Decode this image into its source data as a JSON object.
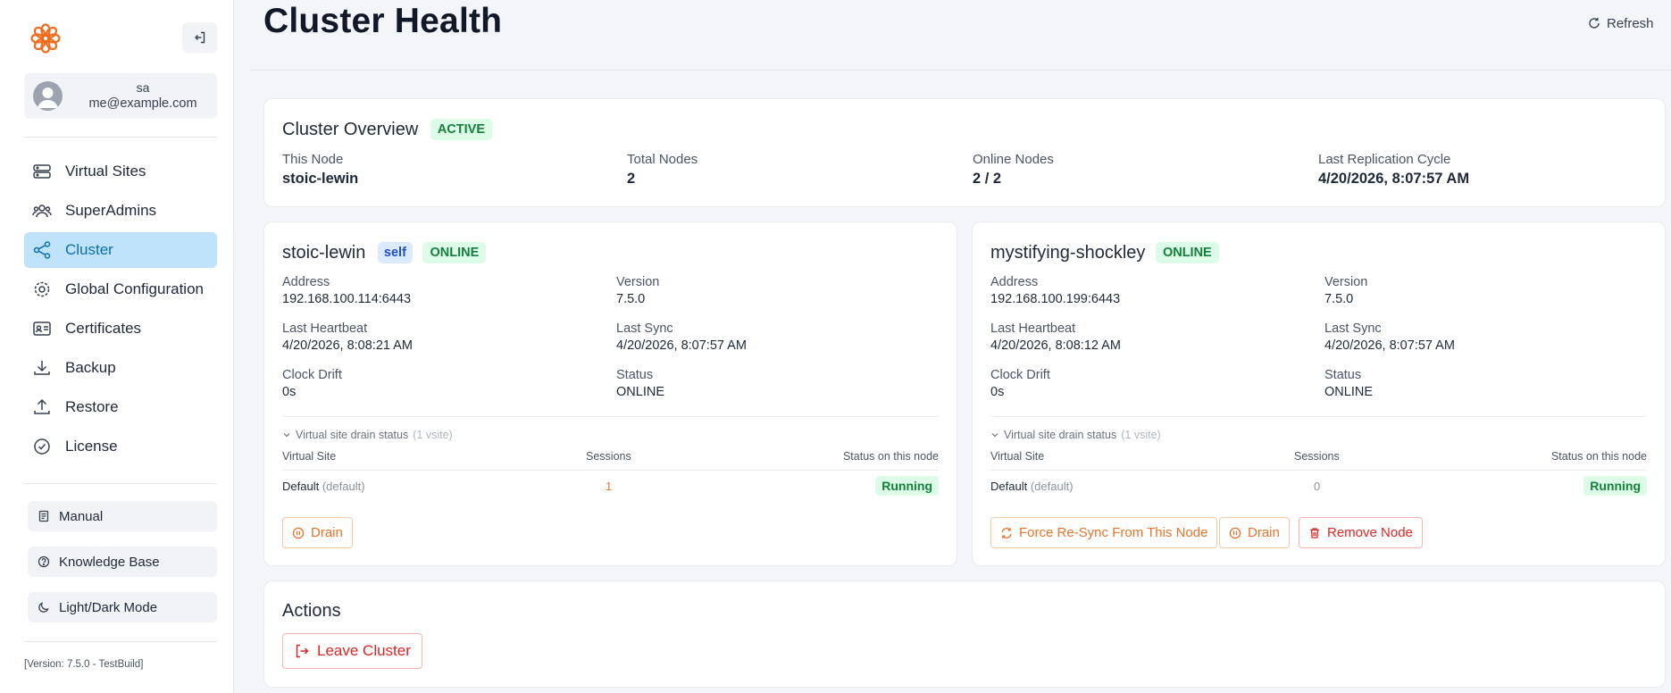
{
  "sidebar": {
    "user": {
      "name": "sa",
      "email": "me@example.com"
    },
    "nav": [
      {
        "label": "Virtual Sites",
        "icon": "server-stack-icon"
      },
      {
        "label": "SuperAdmins",
        "icon": "users-icon"
      },
      {
        "label": "Cluster",
        "icon": "share-nodes-icon",
        "active": true
      },
      {
        "label": "Global Configuration",
        "icon": "gear-icon"
      },
      {
        "label": "Certificates",
        "icon": "id-card-icon"
      },
      {
        "label": "Backup",
        "icon": "download-icon"
      },
      {
        "label": "Restore",
        "icon": "upload-icon"
      },
      {
        "label": "License",
        "icon": "check-badge-icon"
      }
    ],
    "footer": [
      {
        "label": "Manual",
        "icon": "document-icon"
      },
      {
        "label": "Knowledge Base",
        "icon": "question-circle-icon"
      },
      {
        "label": "Light/Dark Mode",
        "icon": "moon-icon"
      }
    ],
    "version": "[Version: 7.5.0 - TestBuild]"
  },
  "header": {
    "title": "Cluster Health",
    "refresh_label": "Refresh"
  },
  "overview": {
    "title": "Cluster Overview",
    "status": "ACTIVE",
    "fields": [
      {
        "label": "This Node",
        "value": "stoic-lewin"
      },
      {
        "label": "Total Nodes",
        "value": "2"
      },
      {
        "label": "Online Nodes",
        "value": "2 / 2"
      },
      {
        "label": "Last Replication Cycle",
        "value": "4/20/2026, 8:07:57 AM"
      }
    ]
  },
  "nodes": [
    {
      "name": "stoic-lewin",
      "self_badge": "self",
      "status_badge": "ONLINE",
      "fields": [
        {
          "label": "Address",
          "value": "192.168.100.114:6443"
        },
        {
          "label": "Version",
          "value": "7.5.0"
        },
        {
          "label": "Last Heartbeat",
          "value": "4/20/2026, 8:08:21 AM"
        },
        {
          "label": "Last Sync",
          "value": "4/20/2026, 8:07:57 AM"
        },
        {
          "label": "Clock Drift",
          "value": "0s"
        },
        {
          "label": "Status",
          "value": "ONLINE"
        }
      ],
      "drain": {
        "heading": "Virtual site drain status",
        "count": "(1 vsite)",
        "columns": [
          "Virtual Site",
          "Sessions",
          "Status on this node"
        ],
        "rows": [
          {
            "site": "Default",
            "tag": "(default)",
            "sessions": "1",
            "status": "Running"
          }
        ]
      },
      "actions": [
        {
          "label": "Drain",
          "icon": "pause-circle-icon"
        }
      ]
    },
    {
      "name": "mystifying-shockley",
      "status_badge": "ONLINE",
      "fields": [
        {
          "label": "Address",
          "value": "192.168.100.199:6443"
        },
        {
          "label": "Version",
          "value": "7.5.0"
        },
        {
          "label": "Last Heartbeat",
          "value": "4/20/2026, 8:08:12 AM"
        },
        {
          "label": "Last Sync",
          "value": "4/20/2026, 8:07:57 AM"
        },
        {
          "label": "Clock Drift",
          "value": "0s"
        },
        {
          "label": "Status",
          "value": "ONLINE"
        }
      ],
      "drain": {
        "heading": "Virtual site drain status",
        "count": "(1 vsite)",
        "columns": [
          "Virtual Site",
          "Sessions",
          "Status on this node"
        ],
        "rows": [
          {
            "site": "Default",
            "tag": "(default)",
            "sessions": "0",
            "status": "Running"
          }
        ]
      },
      "actions": [
        {
          "label": "Force Re-Sync From This Node",
          "icon": "sync-icon"
        },
        {
          "label": "Drain",
          "icon": "pause-circle-icon"
        },
        {
          "label": "Remove Node",
          "icon": "trash-icon"
        }
      ]
    }
  ],
  "actions": {
    "title": "Actions",
    "leave_label": "Leave Cluster"
  },
  "colors": {
    "accent": "#0b6fb0",
    "active_nav_bg": "#bfe3fb",
    "success_bg": "#dcfce7",
    "success_text": "#15803d",
    "warning": "#e8742c",
    "danger": "#dc2626",
    "logo": "#f26a1b"
  }
}
